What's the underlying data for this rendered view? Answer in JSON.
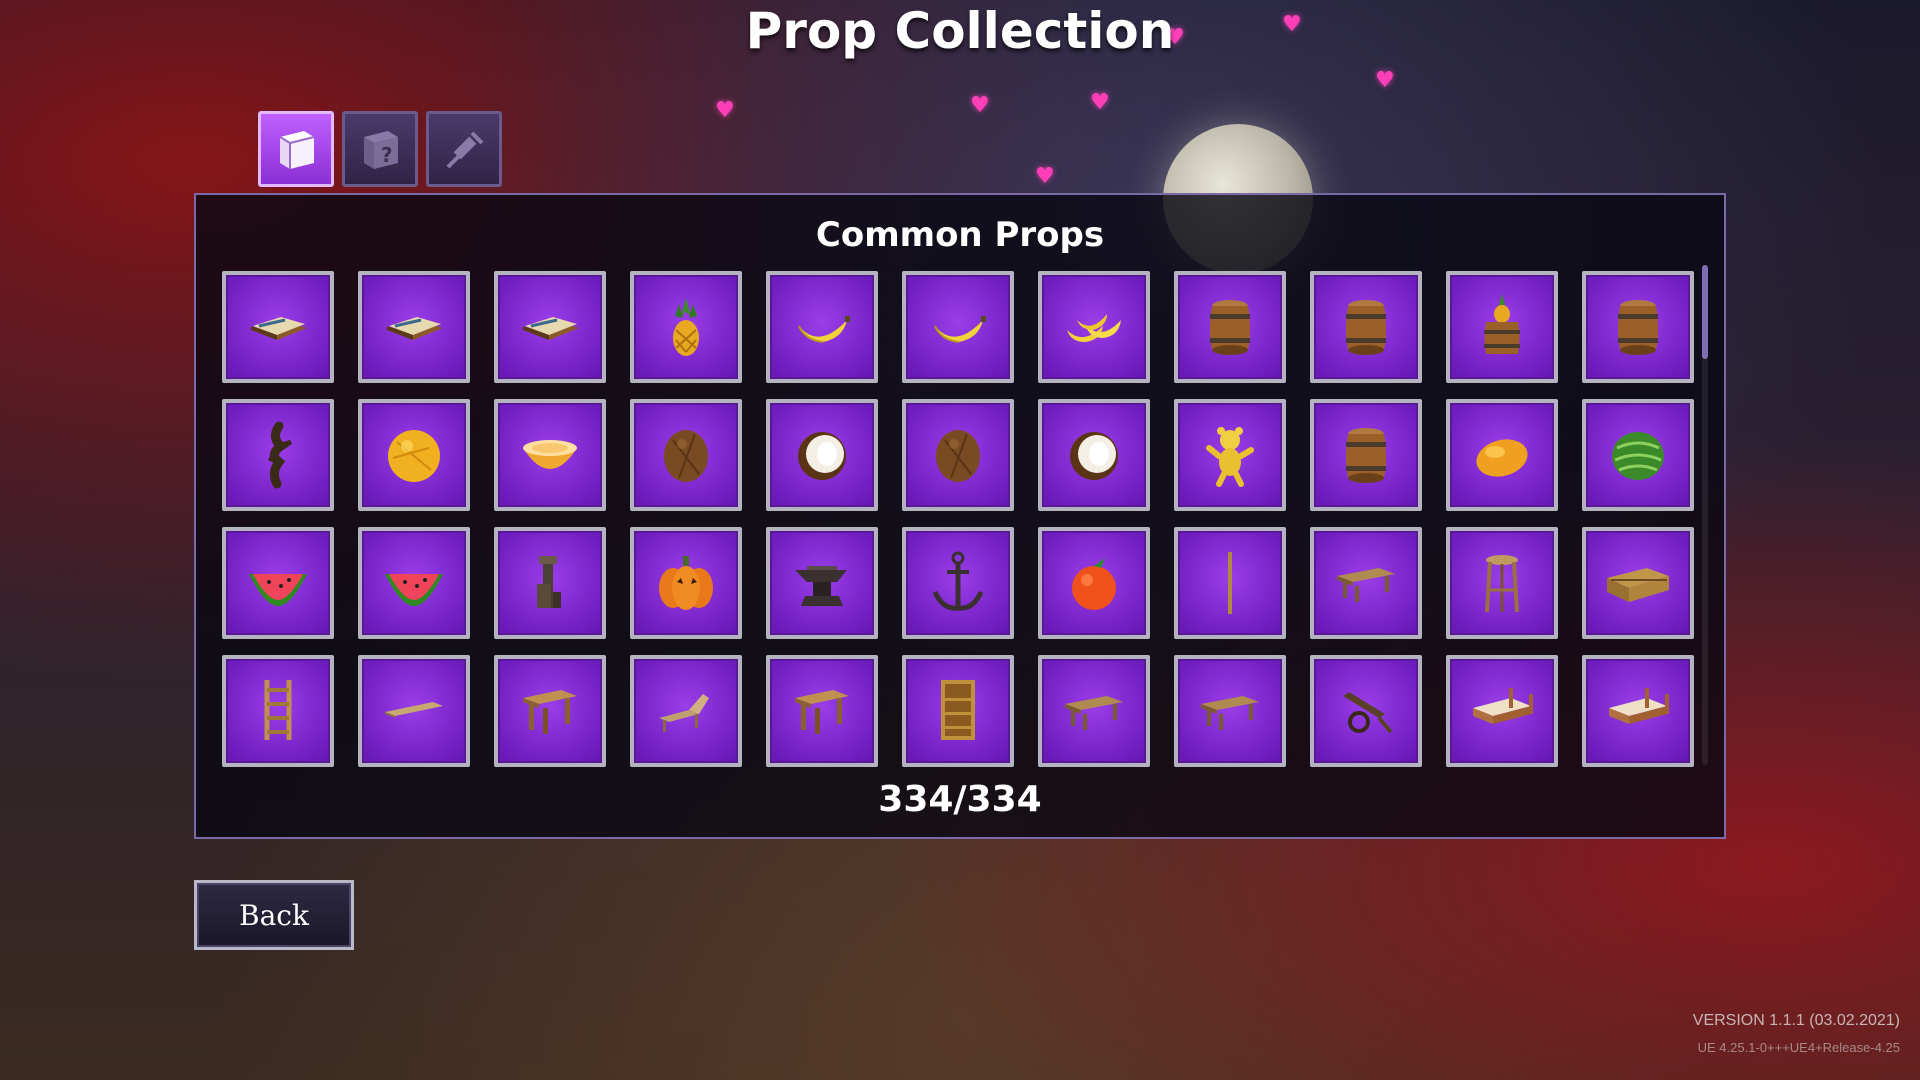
{
  "title": "Prop Collection",
  "tabs": [
    {
      "icon": "cube-icon",
      "active": true
    },
    {
      "icon": "mystery-box-icon",
      "active": false
    },
    {
      "icon": "syringe-icon",
      "active": false
    }
  ],
  "panel": {
    "title": "Common Props",
    "counter": "334/334"
  },
  "props": [
    {
      "icon": "book-icon"
    },
    {
      "icon": "book-icon"
    },
    {
      "icon": "book-icon"
    },
    {
      "icon": "pineapple-icon"
    },
    {
      "icon": "banana-icon"
    },
    {
      "icon": "banana-icon"
    },
    {
      "icon": "banana-bunch-icon"
    },
    {
      "icon": "barrel-icon"
    },
    {
      "icon": "barrel-icon"
    },
    {
      "icon": "pineapple-barrel-icon"
    },
    {
      "icon": "barrel-icon"
    },
    {
      "icon": "root-icon"
    },
    {
      "icon": "melon-icon"
    },
    {
      "icon": "melon-half-icon"
    },
    {
      "icon": "coconut-icon"
    },
    {
      "icon": "coconut-half-icon"
    },
    {
      "icon": "coconut-icon"
    },
    {
      "icon": "coconut-half-icon"
    },
    {
      "icon": "teddy-bear-icon"
    },
    {
      "icon": "barrel-icon"
    },
    {
      "icon": "mango-icon"
    },
    {
      "icon": "watermelon-icon"
    },
    {
      "icon": "watermelon-slice-icon"
    },
    {
      "icon": "watermelon-slice-icon"
    },
    {
      "icon": "chimney-icon"
    },
    {
      "icon": "pumpkin-icon"
    },
    {
      "icon": "anvil-icon"
    },
    {
      "icon": "anchor-icon"
    },
    {
      "icon": "orange-icon"
    },
    {
      "icon": "stick-icon"
    },
    {
      "icon": "bench-icon"
    },
    {
      "icon": "stool-icon"
    },
    {
      "icon": "crate-icon"
    },
    {
      "icon": "ladder-icon"
    },
    {
      "icon": "plank-icon"
    },
    {
      "icon": "table-icon"
    },
    {
      "icon": "lounge-chair-icon"
    },
    {
      "icon": "table-icon"
    },
    {
      "icon": "shelf-icon"
    },
    {
      "icon": "bench-icon"
    },
    {
      "icon": "bench-icon"
    },
    {
      "icon": "cart-icon"
    },
    {
      "icon": "bed-icon"
    },
    {
      "icon": "bed-icon"
    }
  ],
  "back_label": "Back",
  "version": {
    "line1": "VERSION 1.1.1 (03.02.2021)",
    "line2": "UE 4.25.1-0+++UE4+Release-4.25"
  },
  "colors": {
    "slot_purple": "#7420c4",
    "tab_active": "#a445ec",
    "heart_pink": "#ff3fb8"
  }
}
